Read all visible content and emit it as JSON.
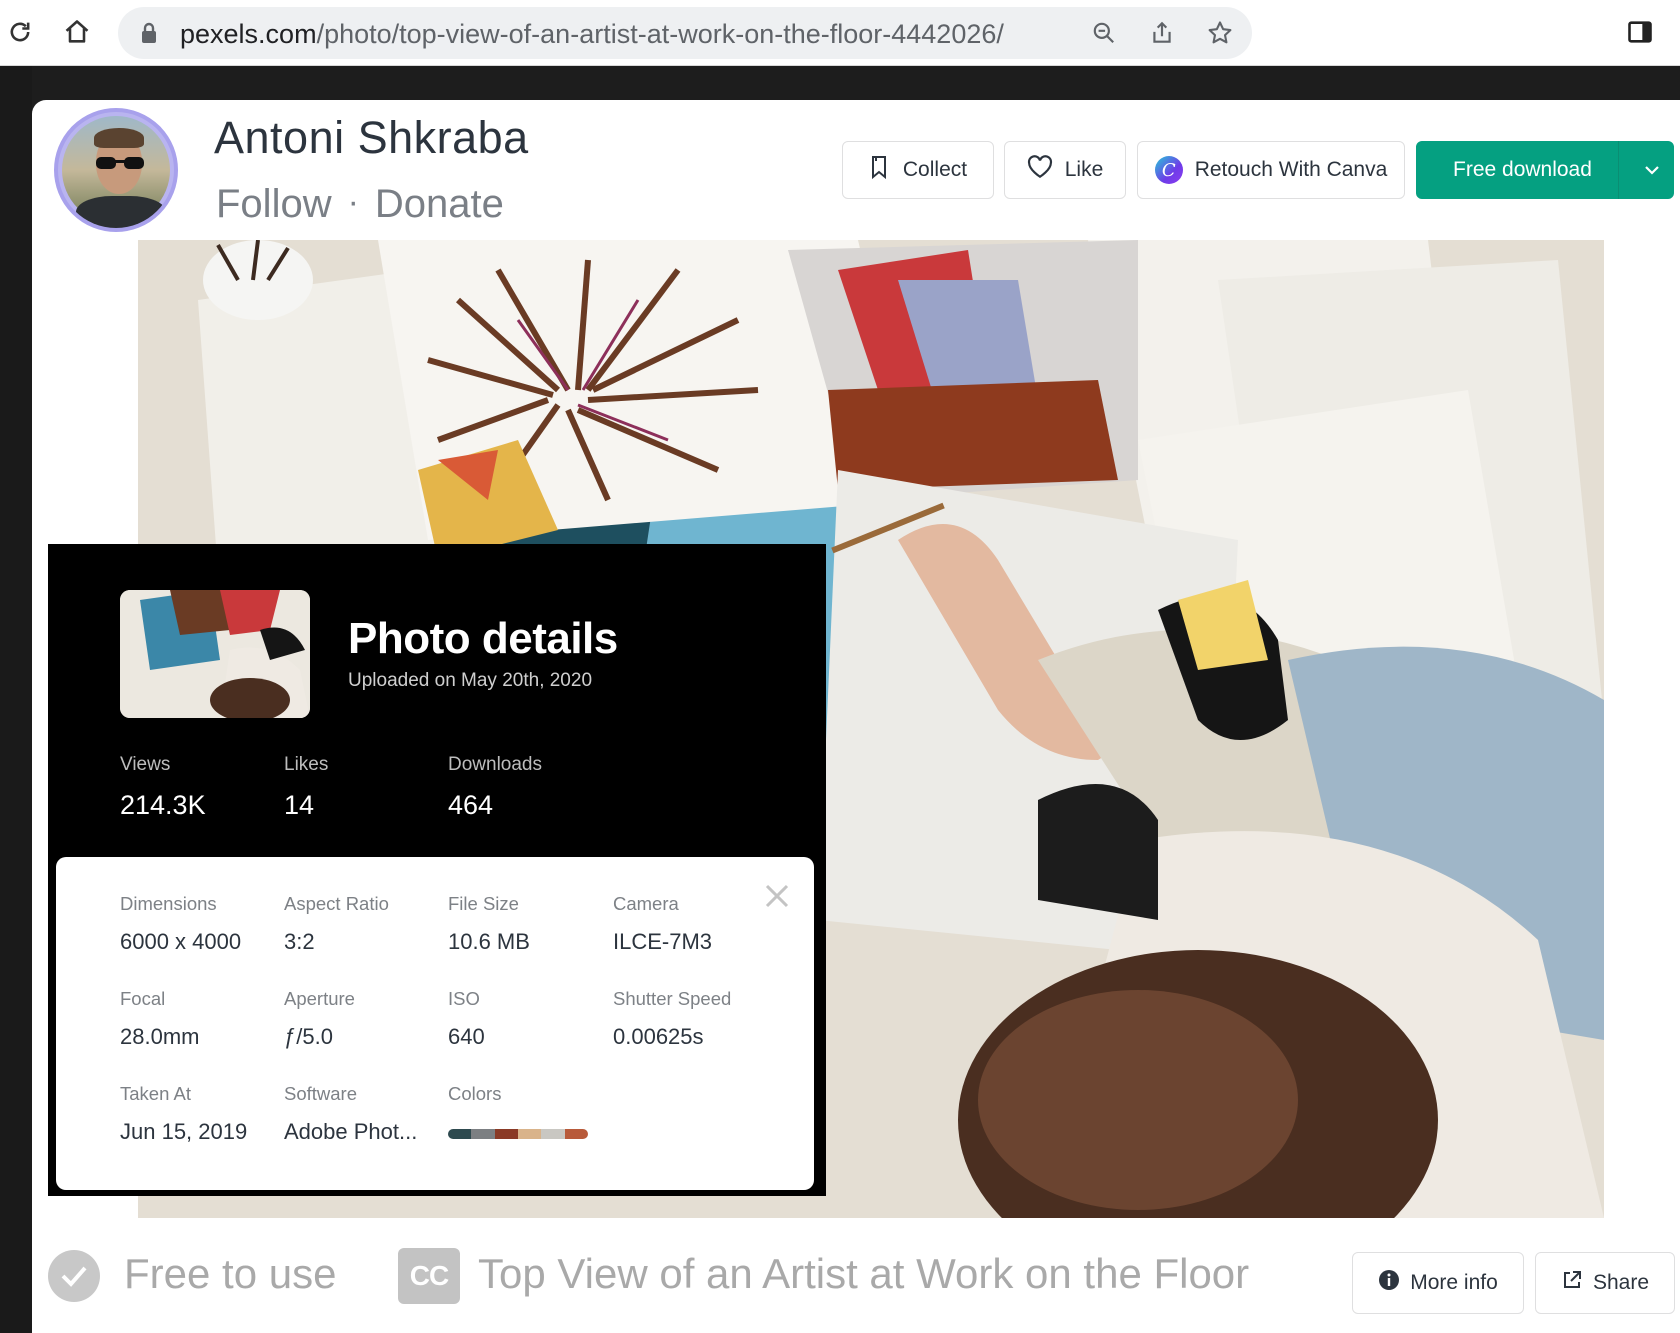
{
  "browser": {
    "url_host": "pexels.com",
    "url_path": "/photo/top-view-of-an-artist-at-work-on-the-floor-4442026/"
  },
  "author": {
    "name": "Antoni Shkraba",
    "follow_label": "Follow",
    "separator": "·",
    "donate_label": "Donate"
  },
  "actions": {
    "collect_label": "Collect",
    "like_label": "Like",
    "canva_label": "Retouch With Canva",
    "download_label": "Free download"
  },
  "details": {
    "title": "Photo details",
    "uploaded": "Uploaded on May 20th, 2020",
    "stats": [
      {
        "label": "Views",
        "value": "214.3K"
      },
      {
        "label": "Likes",
        "value": "14"
      },
      {
        "label": "Downloads",
        "value": "464"
      }
    ],
    "specs": [
      {
        "label": "Dimensions",
        "value": "6000 x 4000"
      },
      {
        "label": "Aspect Ratio",
        "value": "3:2"
      },
      {
        "label": "File Size",
        "value": "10.6 MB"
      },
      {
        "label": "Camera",
        "value": "ILCE-7M3"
      },
      {
        "label": "Focal",
        "value": "28.0mm"
      },
      {
        "label": "Aperture",
        "value": "ƒ/5.0"
      },
      {
        "label": "ISO",
        "value": "640"
      },
      {
        "label": "Shutter Speed",
        "value": "0.00625s"
      },
      {
        "label": "Taken At",
        "value": "Jun 15, 2019"
      },
      {
        "label": "Software",
        "value": "Adobe Phot..."
      },
      {
        "label": "Colors",
        "value": ""
      }
    ],
    "colors": [
      "#2e4a4f",
      "#7c7f82",
      "#8a3a26",
      "#d9b38a",
      "#c9c7c2",
      "#b85a3a"
    ]
  },
  "footer": {
    "license_label": "Free to use",
    "cc_badge": "CC",
    "photo_title": "Top View of an Artist at Work on the Floor",
    "more_info_label": "More info",
    "share_label": "Share"
  },
  "colors": {
    "accent": "#05a081",
    "text_dark": "#2c343e",
    "text_muted": "#7a7f86"
  }
}
